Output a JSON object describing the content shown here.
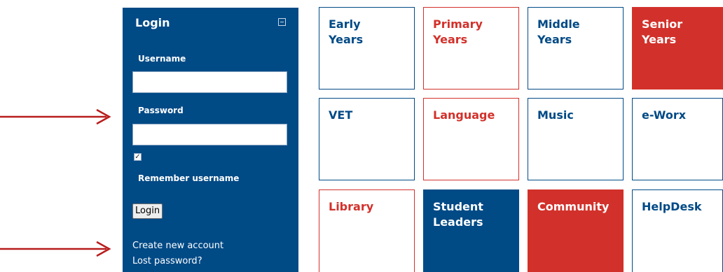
{
  "login": {
    "title": "Login",
    "username_label": "Username",
    "username_value": "",
    "password_label": "Password",
    "password_value": "",
    "remember_checked": true,
    "remember_label": "Remember username",
    "button_label": "Login",
    "create_account_link": "Create new account",
    "lost_password_link": "Lost password?"
  },
  "tiles": {
    "early_years": "Early\nYears",
    "primary_years": "Primary\nYears",
    "middle_years": "Middle\nYears",
    "senior_years": "Senior\nYears",
    "vet": "VET",
    "language": "Language",
    "music": "Music",
    "eworx": "e-Worx",
    "library": "Library",
    "student_leaders": "Student\nLeaders",
    "community": "Community",
    "helpdesk": "HelpDesk"
  },
  "colors": {
    "navy": "#004a86",
    "red": "#d2312b",
    "arrow": "#b81c1c"
  },
  "icons": {
    "arrow": "right-arrow",
    "collapse": "minimize-icon",
    "check": "checkmark"
  }
}
